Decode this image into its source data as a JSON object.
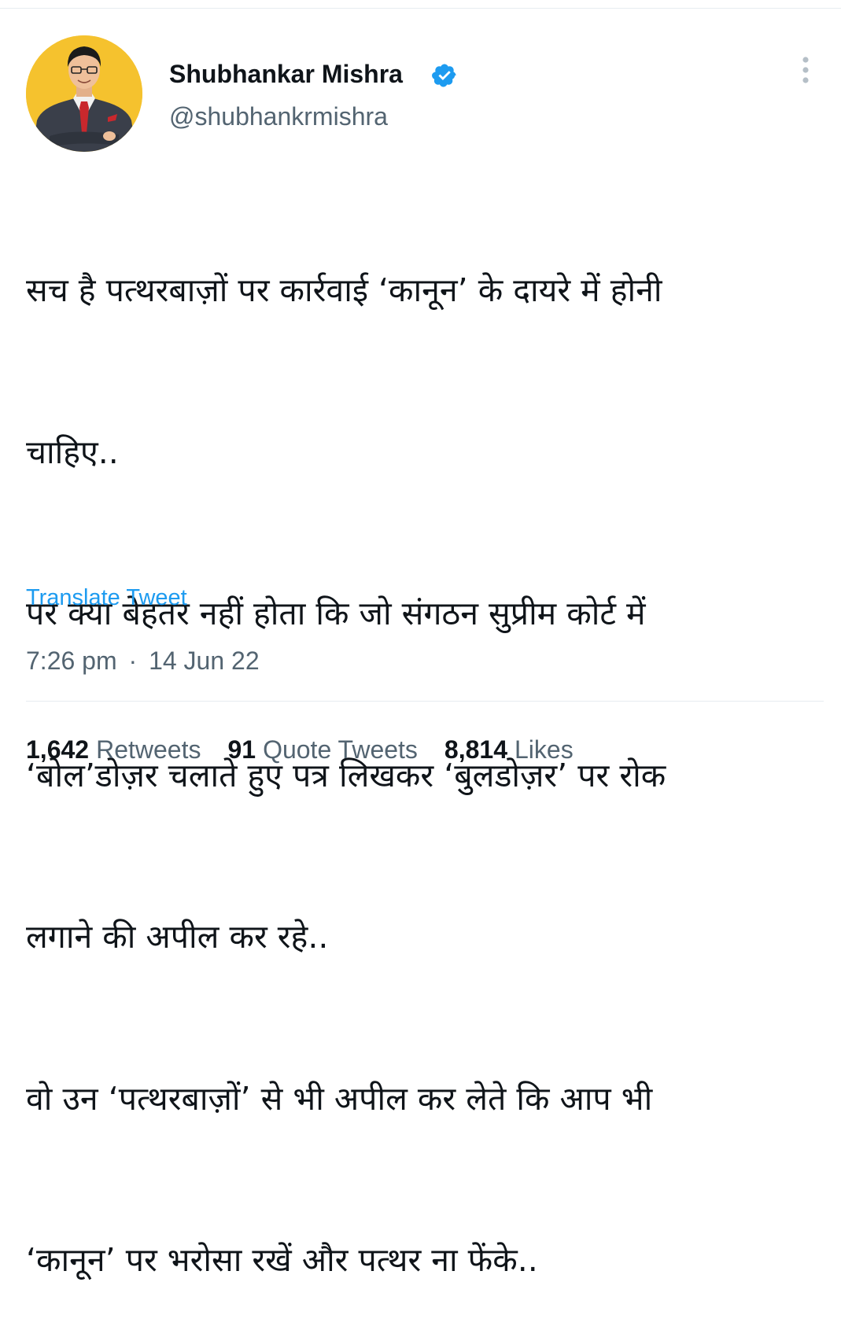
{
  "author": {
    "name": "Shubhankar Mishra",
    "handle": "@shubhankrmishra",
    "verified": true,
    "avatar_bg": "#f5c22e"
  },
  "tweet": {
    "lines": [
      "सच है पत्थरबाज़ों पर कार्रवाई ‘कानून’ के दायरे में होनी",
      "चाहिए..",
      "पर क्या बेहतर नहीं होता कि जो संगठन सुप्रीम कोर्ट में",
      "‘बोल’डोज़र चलाते हुए पत्र लिखकर ‘बुलडोज़र’ पर रोक",
      "लगाने की अपील कर रहे..",
      "वो उन ‘पत्थरबाज़ों’ से भी अपील कर लेते कि आप भी",
      "‘कानून’ पर भरोसा रखें और पत्थर ना फेंके.."
    ],
    "translate_label": "Translate Tweet",
    "time": "7:26 pm",
    "separator": "·",
    "date": "14 Jun 22"
  },
  "stats": {
    "retweets": {
      "count": "1,642",
      "label": "Retweets"
    },
    "quote_tweets": {
      "count": "91",
      "label": "Quote Tweets"
    },
    "likes": {
      "count": "8,814",
      "label": "Likes"
    }
  },
  "icons": {
    "verified": "verified-badge-icon",
    "more": "more-vertical-icon"
  },
  "colors": {
    "link": "#1d9bf0",
    "secondary_text": "#536471",
    "primary_text": "#0f1419"
  }
}
